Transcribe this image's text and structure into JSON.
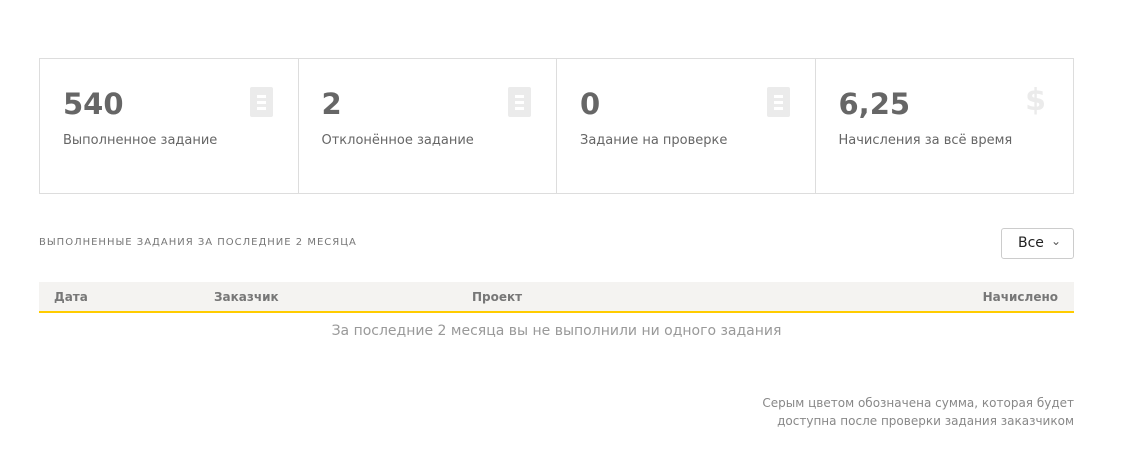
{
  "cards": [
    {
      "value": "540",
      "label": "Выполненное задание",
      "icon": "document-icon"
    },
    {
      "value": "2",
      "label": "Отклонённое задание",
      "icon": "document-icon"
    },
    {
      "value": "0",
      "label": "Задание на проверке",
      "icon": "document-icon"
    },
    {
      "value": "6,25",
      "label": "Начисления за всё время",
      "icon": "dollar-icon",
      "icon_glyph": "$"
    }
  ],
  "section_title": "ВЫПОЛНЕННЫЕ ЗАДАНИЯ ЗА ПОСЛЕДНИЕ 2 МЕСЯЦА",
  "filter": {
    "value": "Все"
  },
  "table": {
    "columns": [
      "Дата",
      "Заказчик",
      "Проект",
      "Начислено"
    ],
    "empty": "За последние 2 месяца вы не выполнили ни одного задания"
  },
  "note": {
    "line1": "Серым цветом обозначена сумма, которая будет",
    "line2": "доступна после проверки задания заказчиком"
  },
  "colors": {
    "accent": "#ffcc00",
    "header_bg": "#f4f3f1"
  }
}
